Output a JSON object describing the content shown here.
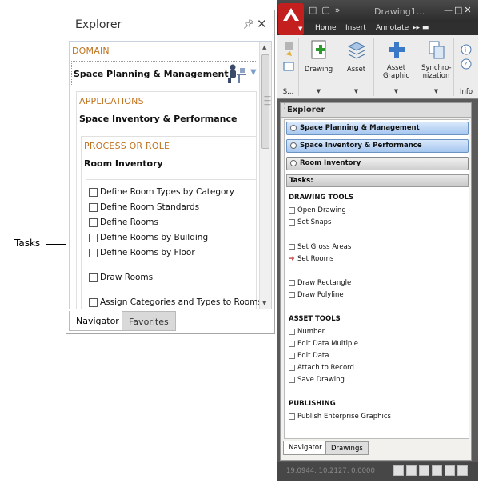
{
  "annotation": {
    "label": "Tasks"
  },
  "explorer_left": {
    "title": "Explorer",
    "pin_icon": "pin-icon",
    "close_icon": "close-icon",
    "domain": {
      "label": "DOMAIN",
      "value": "Space Planning & Management"
    },
    "applications": {
      "label": "APPLICATIONS",
      "value": "Space Inventory & Performance"
    },
    "process": {
      "label": "PROCESS OR ROLE",
      "value": "Room Inventory"
    },
    "tasks": [
      "Define Room Types by Category",
      "Define Room Standards",
      "Define Rooms",
      "Define Rooms by Building",
      "Define Rooms by Floor",
      "Draw Rooms",
      "Assign Categories and Types to Rooms"
    ],
    "tabs": [
      "Navigator",
      "Favorites"
    ]
  },
  "app_window": {
    "title": "Drawing1...",
    "menu": [
      "Home",
      "Insert",
      "Annotate"
    ],
    "ribbon": {
      "buttons": [
        {
          "label": "Drawing"
        },
        {
          "label": "Asset"
        },
        {
          "label": "Asset Graphic"
        },
        {
          "label": "Synchro-nization"
        }
      ],
      "panel_s": "S...",
      "panel_info": "Info"
    },
    "explorer": {
      "title": "Explorer",
      "breadcrumbs": [
        "Space Planning & Management",
        "Space Inventory & Performance",
        "Room Inventory"
      ],
      "tasks_label": "Tasks:",
      "groups": {
        "drawing_tools": {
          "title": "DRAWING TOOLS",
          "items": [
            "Open Drawing",
            "Set Snaps",
            "Set Gross Areas",
            "Set Rooms",
            "Draw Rectangle",
            "Draw Polyline"
          ]
        },
        "asset_tools": {
          "title": "ASSET TOOLS",
          "items": [
            "Number",
            "Edit Data Multiple",
            "Edit Data",
            "Attach to Record",
            "Save Drawing"
          ]
        },
        "publishing": {
          "title": "PUBLISHING",
          "items": [
            "Publish Enterprise Graphics"
          ]
        }
      },
      "tabs": [
        "Navigator",
        "Drawings"
      ]
    },
    "status": {
      "coords": "19.0944, 10.2127, 0.0000"
    }
  }
}
